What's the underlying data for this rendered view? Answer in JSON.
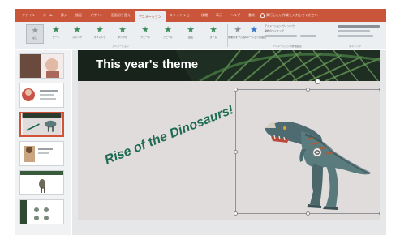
{
  "ribbon": {
    "tabs": [
      "ファイル",
      "ホーム",
      "挿入",
      "描画",
      "デザイン",
      "画面切り替え",
      "アニメーション",
      "スライド ショー",
      "校閲",
      "表示",
      "ヘルプ",
      "書式"
    ],
    "active_tab": "アニメーション",
    "tell_me": "実行したい作業を入力してください",
    "animation_gallery": [
      {
        "label": "なし",
        "icon": "star-none-icon"
      },
      {
        "label": "ターン",
        "icon": "star-icon"
      },
      {
        "label": "ジャンプ",
        "icon": "star-icon"
      },
      {
        "label": "スウィング",
        "icon": "star-icon"
      },
      {
        "label": "タンブル",
        "icon": "star-icon"
      },
      {
        "label": "フェード",
        "icon": "star-icon"
      },
      {
        "label": "アピール",
        "icon": "star-icon"
      },
      {
        "label": "回転",
        "icon": "star-icon"
      },
      {
        "label": "ズーム",
        "icon": "star-icon"
      }
    ],
    "group_animation_label": "アニメーション",
    "effect_options_label": "効果のオプション",
    "add_animation_label": "アニメーションの追加",
    "advanced_group_label": "アニメーションの詳細設定",
    "timing_group_label": "タイミング",
    "animation_pane_label": "アニメーション ウィンドウ",
    "trigger_label": "開始のタイミング",
    "accent_color": "#c9553a",
    "icon_color": "#3c8c5b"
  },
  "thumbnails": [
    {
      "index": 1,
      "selected": false
    },
    {
      "index": 2,
      "selected": false
    },
    {
      "index": 3,
      "selected": true
    },
    {
      "index": 4,
      "selected": false
    },
    {
      "index": 5,
      "selected": false
    },
    {
      "index": 6,
      "selected": false
    }
  ],
  "slide": {
    "title": "This year's theme",
    "wordart": "Rise of the Dinosaurs!",
    "model": "3D T-Rex model",
    "title_color": "#ffffff",
    "wordart_color": "#1e6b54"
  }
}
